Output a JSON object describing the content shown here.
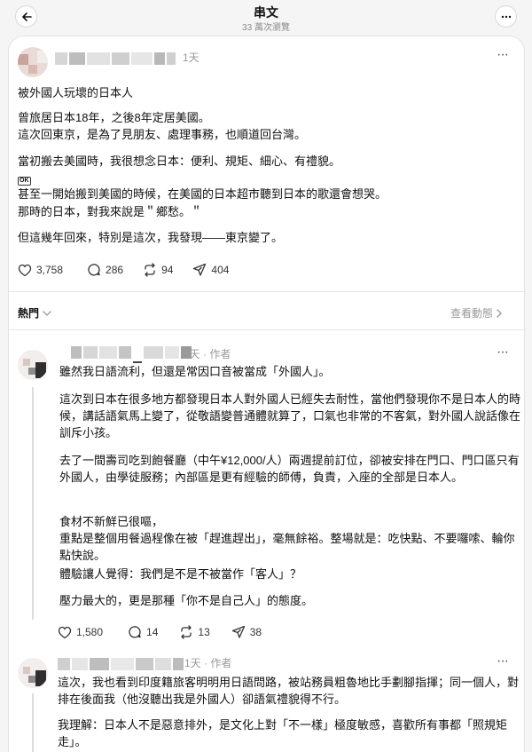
{
  "header": {
    "title": "串文",
    "subtitle": "33 萬次瀏覽"
  },
  "post": {
    "time": "1天",
    "lines": [
      "被外國人玩壞的日本人",
      "曾旅居日本18年，之後8年定居美國。",
      "這次回東京，是為了見朋友、處理事務，也順道回台灣。",
      "當初搬去美國時，我很想念日本：便利、規矩、細心、有禮貌。",
      "甚至一開始搬到美國的時候，在美國的日本超市聽到日本的歌還會想哭。",
      "那時的日本，對我來說是＂鄉愁。＂",
      "但這幾年回來，特別是這次，我發現——東京變了。"
    ],
    "badge": "OK",
    "likes": "3,758",
    "comments": "286",
    "reposts": "94",
    "shares": "404"
  },
  "sort": {
    "label": "熱門",
    "activity_label": "查看動態"
  },
  "reply1": {
    "time": "1天",
    "author_tag": "作者",
    "first_line": "雖然我日語流利，但還是常因口音被當成「外國人」。",
    "para1": "這次到日本在很多地方都發現日本人對外國人已經失去耐性，當他們發現你不是日本人的時候，講話語氣馬上變了，從敬語變普通體就算了，口氣也非常的不客氣，對外國人說話像在訓斥小孩。",
    "para2": "去了一間壽司吃到飽餐廳（中午¥12,000/人）兩週提前訂位，卻被安排在門口、門口區只有外國人，由學徒服務；內部區是更有經驗的師傅，負責，入座的全部是日本人。",
    "para3_l1": "食材不新鮮已很嘔，",
    "para3_l2": "重點是整個用餐過程像在被「趕進趕出」，毫無餘裕。整場就是：吃快點、不要囉嗦、輪你點快說。",
    "para3_l3": "體驗讓人覺得：我們是不是不被當作「客人」？",
    "para4": "壓力最大的，更是那種「你不是自己人」的態度。",
    "likes": "1,580",
    "comments": "14",
    "reposts": "13",
    "shares": "38"
  },
  "reply2": {
    "time": "1天",
    "author_tag": "作者",
    "para1": "這次，我也看到印度籍旅客明明用日語問路，被站務員粗魯地比手劃腳指揮；同一個人，對排在後面我（他沒聽出我是外國人）卻語氣禮貌得不行。",
    "para2": "我理解：日本人不是惡意排外，是文化上對「不一樣」極度敏感，喜歡所有事都「照規矩走」。"
  }
}
